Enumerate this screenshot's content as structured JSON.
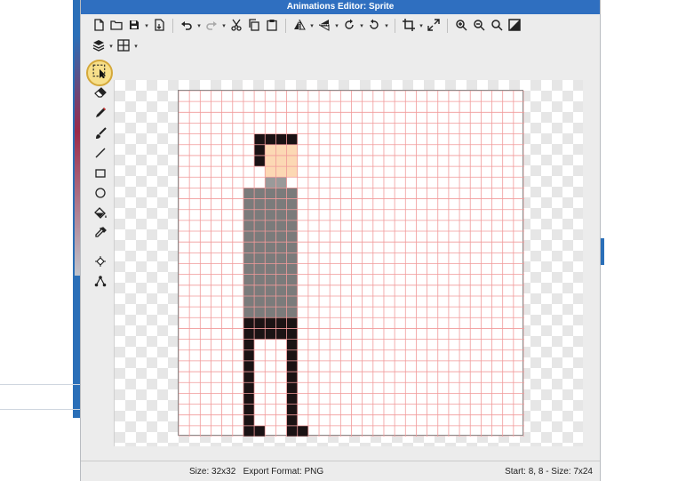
{
  "window": {
    "title": "Animations Editor: Sprite"
  },
  "toolbar_row1": [
    {
      "icon": "new-file-icon",
      "dropdown": false
    },
    {
      "icon": "open-folder-icon",
      "dropdown": false
    },
    {
      "icon": "save-icon",
      "dropdown": true
    },
    {
      "icon": "export-icon",
      "dropdown": false
    },
    {
      "sep": true
    },
    {
      "icon": "undo-icon",
      "dropdown": true
    },
    {
      "icon": "redo-icon",
      "dropdown": true
    },
    {
      "icon": "cut-icon",
      "dropdown": false
    },
    {
      "icon": "copy-icon",
      "dropdown": false
    },
    {
      "icon": "paste-icon",
      "dropdown": false
    },
    {
      "sep": true
    },
    {
      "icon": "flip-horizontal-icon",
      "dropdown": true
    },
    {
      "icon": "flip-vertical-icon",
      "dropdown": true
    },
    {
      "icon": "rotate-left-icon",
      "dropdown": true
    },
    {
      "icon": "rotate-right-icon",
      "dropdown": true
    },
    {
      "sep": true
    },
    {
      "icon": "crop-icon",
      "dropdown": true
    },
    {
      "icon": "resize-icon",
      "dropdown": false
    },
    {
      "sep": true
    },
    {
      "icon": "zoom-in-icon",
      "dropdown": false
    },
    {
      "icon": "zoom-out-icon",
      "dropdown": false
    },
    {
      "icon": "zoom-fit-icon",
      "dropdown": false
    },
    {
      "icon": "invert-colors-icon",
      "dropdown": false
    }
  ],
  "toolbar_row2": [
    {
      "icon": "layers-icon",
      "dropdown": true
    },
    {
      "icon": "grid-icon",
      "dropdown": true
    }
  ],
  "tools": [
    {
      "icon": "selection-tool-icon",
      "active": true
    },
    {
      "icon": "eraser-tool-icon"
    },
    {
      "icon": "pencil-tool-icon"
    },
    {
      "icon": "brush-tool-icon"
    },
    {
      "icon": "line-tool-icon"
    },
    {
      "icon": "rectangle-tool-icon"
    },
    {
      "icon": "ellipse-tool-icon"
    },
    {
      "icon": "fill-bucket-tool-icon"
    },
    {
      "icon": "eyedropper-tool-icon"
    },
    {
      "icon": "move-point-tool-icon"
    },
    {
      "icon": "anchor-tool-icon"
    }
  ],
  "sprite": {
    "grid_size": 32,
    "colors": {
      "background": "#ffffff",
      "grid": "#f19a9a",
      "hair": "#1a1214",
      "skin": "#fcd8b4",
      "neck": "#9a9a9a",
      "shirt": "#7b7b7b",
      "pants": "#1b1314",
      "shoes": "#1a1214"
    }
  },
  "status": {
    "size_text": "Size: 32x32",
    "export_text": "Export Format: PNG",
    "selection_text": "Start: 8, 8 - Size: 7x24"
  }
}
